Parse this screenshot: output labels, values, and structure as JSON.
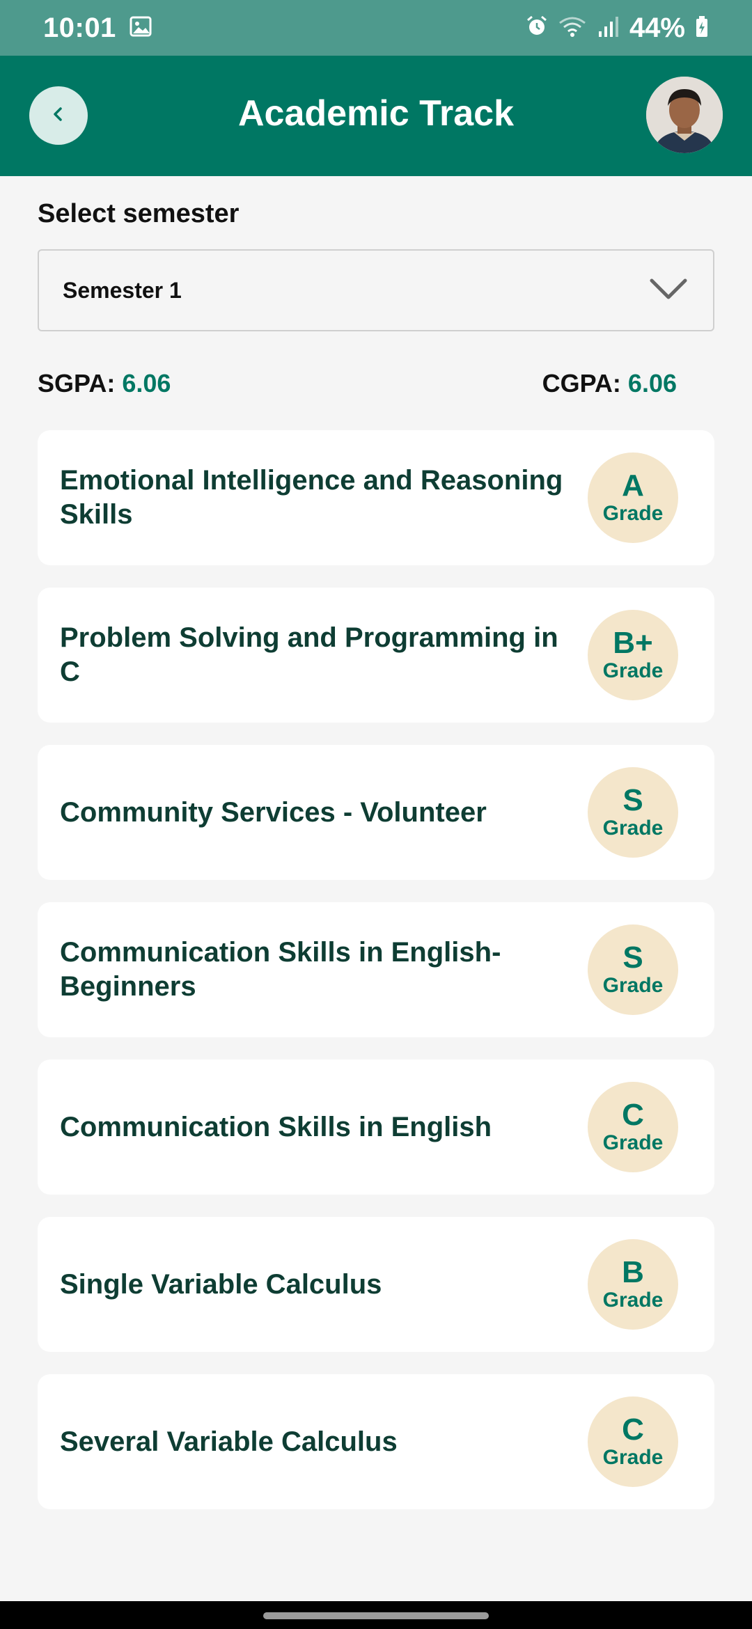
{
  "status_bar": {
    "time": "10:01",
    "battery": "44%",
    "icons": [
      "gallery-icon",
      "alarm-icon",
      "wifi-icon",
      "signal-icon",
      "battery-charging-icon"
    ]
  },
  "header": {
    "title": "Academic Track",
    "back_icon": "chevron-left-icon",
    "avatar": "profile-avatar"
  },
  "semester": {
    "label": "Select semester",
    "selected": "Semester 1",
    "dropdown_icon": "chevron-down-icon"
  },
  "gpa": {
    "sgpa_label": "SGPA:",
    "sgpa_value": "6.06",
    "cgpa_label": "CGPA:",
    "cgpa_value": "6.06"
  },
  "courses": [
    {
      "name": "Emotional Intelligence and Reasoning Skills",
      "grade": "A",
      "grade_label": "Grade"
    },
    {
      "name": "Problem Solving and Programming in C",
      "grade": "B+",
      "grade_label": "Grade"
    },
    {
      "name": "Community Services - Volunteer",
      "grade": "S",
      "grade_label": "Grade"
    },
    {
      "name": "Communication Skills in English-Beginners",
      "grade": "S",
      "grade_label": "Grade"
    },
    {
      "name": "Communication Skills in English",
      "grade": "C",
      "grade_label": "Grade"
    },
    {
      "name": "Single Variable Calculus",
      "grade": "B",
      "grade_label": "Grade"
    },
    {
      "name": "Several Variable Calculus",
      "grade": "C",
      "grade_label": "Grade"
    }
  ],
  "colors": {
    "primary": "#007763",
    "status_bar": "#4e9a8d",
    "badge_bg": "#f4e6cb",
    "course_text": "#0e3d33"
  }
}
